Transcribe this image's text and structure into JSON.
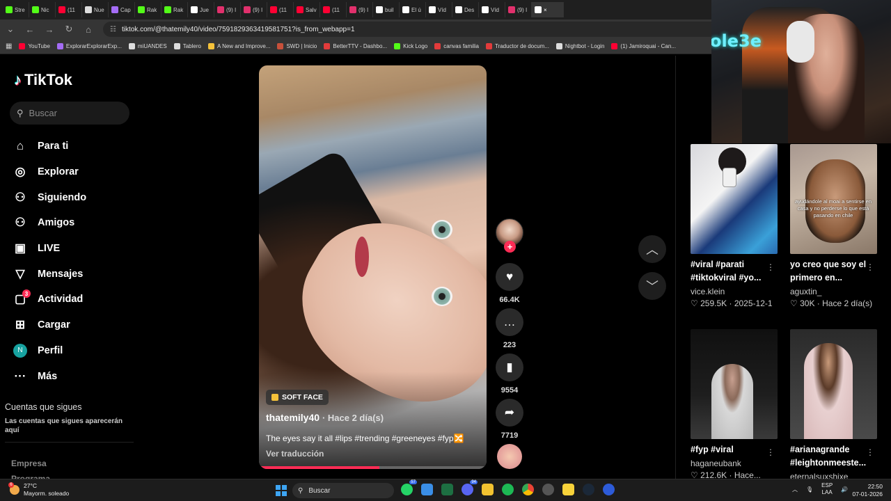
{
  "browser": {
    "tabs": [
      {
        "label": "Stre",
        "icon": "kick-icon",
        "color": "#53fc18"
      },
      {
        "label": "Nic",
        "icon": "kick-icon",
        "color": "#53fc18"
      },
      {
        "label": "(11",
        "icon": "youtube-icon",
        "color": "#ff0033"
      },
      {
        "label": "Nue",
        "icon": "openai-icon",
        "color": "#dddddd"
      },
      {
        "label": "Cap",
        "icon": "capcut-icon",
        "color": "#a46cf5"
      },
      {
        "label": "Rak",
        "icon": "kick-icon",
        "color": "#53fc18"
      },
      {
        "label": "Rak",
        "icon": "kick-icon",
        "color": "#53fc18"
      },
      {
        "label": "Jue",
        "icon": "tiktok-icon",
        "color": "#ffffff"
      },
      {
        "label": "(9) I",
        "icon": "instagram-icon",
        "color": "#e1306c"
      },
      {
        "label": "(9) I",
        "icon": "instagram-icon",
        "color": "#e1306c"
      },
      {
        "label": "(11",
        "icon": "youtube-icon",
        "color": "#ff0033"
      },
      {
        "label": "Salv",
        "icon": "youtube-icon",
        "color": "#ff0033"
      },
      {
        "label": "(11",
        "icon": "youtube-icon",
        "color": "#ff0033"
      },
      {
        "label": "(9) I",
        "icon": "instagram-icon",
        "color": "#e1306c"
      },
      {
        "label": "buil",
        "icon": "tiktok-icon",
        "color": "#ffffff"
      },
      {
        "label": "El ú",
        "icon": "tiktok-icon",
        "color": "#ffffff"
      },
      {
        "label": "Víd",
        "icon": "tiktok-icon",
        "color": "#ffffff"
      },
      {
        "label": "Des",
        "icon": "tiktok-icon",
        "color": "#ffffff"
      },
      {
        "label": "Víd",
        "icon": "tiktok-icon",
        "color": "#ffffff"
      },
      {
        "label": "(9) I",
        "icon": "instagram-icon",
        "color": "#e1306c"
      },
      {
        "label": "×",
        "icon": "tiktok-icon",
        "color": "#ffffff",
        "active": true
      }
    ],
    "url": "tiktok.com/@thatemily40/video/7591829363419581751?is_from_webapp=1",
    "bookmarks": [
      {
        "label": "YouTube",
        "color": "#ff0033"
      },
      {
        "label": "ExplorarExplorarExp...",
        "color": "#a46cf5"
      },
      {
        "label": "miUANDES",
        "color": "#dddddd"
      },
      {
        "label": "Tablero",
        "color": "#dddddd"
      },
      {
        "label": "A New and Improve...",
        "color": "#f5c23a"
      },
      {
        "label": "SWD | Inicio",
        "color": "#c8503a"
      },
      {
        "label": "BetterTTV - Dashbo...",
        "color": "#e33b3b"
      },
      {
        "label": "Kick Logo",
        "color": "#53fc18"
      },
      {
        "label": "canvas familia",
        "color": "#e33b3b"
      },
      {
        "label": "Traductor de docum...",
        "color": "#e33b3b"
      },
      {
        "label": "Nightbot - Login",
        "color": "#dddddd"
      },
      {
        "label": "(1) Jamiroquai - Can...",
        "color": "#ff0033"
      }
    ]
  },
  "tiktok": {
    "brand": "TikTok",
    "search_placeholder": "Buscar",
    "nav": [
      {
        "label": "Para ti",
        "icon": "home-icon",
        "glyph": "⌂"
      },
      {
        "label": "Explorar",
        "icon": "compass-icon",
        "glyph": "◎"
      },
      {
        "label": "Siguiendo",
        "icon": "following-icon",
        "glyph": "⚇"
      },
      {
        "label": "Amigos",
        "icon": "friends-icon",
        "glyph": "⚇"
      },
      {
        "label": "LIVE",
        "icon": "live-icon",
        "glyph": "▣"
      },
      {
        "label": "Mensajes",
        "icon": "messages-icon",
        "glyph": "▽"
      },
      {
        "label": "Actividad",
        "icon": "activity-icon",
        "glyph": "▢",
        "badge": "3"
      },
      {
        "label": "Cargar",
        "icon": "upload-icon",
        "glyph": "⊞"
      },
      {
        "label": "Perfil",
        "icon": "profile-avatar",
        "glyph": "N"
      },
      {
        "label": "Más",
        "icon": "more-icon",
        "glyph": "···"
      }
    ],
    "following_heading": "Cuentas que sigues",
    "following_placeholder": "Las cuentas que sigues aparecerán aquí",
    "footer": [
      "Empresa",
      "Programa"
    ]
  },
  "video": {
    "tag": "SOFT FACE",
    "author": "thatemily40",
    "posted": "· Hace 2 día(s)",
    "description": "The eyes say it all #lips #trending #greeneyes #fyp🔀",
    "translate": "Ver traducción",
    "progress": 0.53
  },
  "actions": {
    "likes": "66.4K",
    "comments": "223",
    "saves": "9554",
    "shares": "7719"
  },
  "recommended": [
    {
      "title": "#viral #parati #tiktokviral #yo...",
      "author": "vice.klein",
      "likes": "259.5K",
      "date": "2025-12-1"
    },
    {
      "title": "yo creo que soy el primero en...",
      "author": "aguxtin_",
      "likes": "30K",
      "date": "Hace 2 día(s)",
      "overlay": "ayudándole al moai a sentirse en casa y no perderse lo que está pasando en chile"
    },
    {
      "title": "#fyp #viral",
      "author": "haganeubank",
      "likes": "212.6K",
      "date": "Hace..."
    },
    {
      "title": "#arianagrande #leightonmeeste...",
      "author": "eternalsuxshixe",
      "likes": "",
      "date": ""
    }
  ],
  "webcam": {
    "neon": "ole3e"
  },
  "taskbar": {
    "weather_temp": "27°C",
    "weather_desc": "Mayorm. soleado",
    "weather_badge": "6",
    "search": "Buscar",
    "lang1": "ESP",
    "lang2": "LAA",
    "time": "22:50",
    "date": "07-01-2026",
    "badges": {
      "whatsapp": "57",
      "discord": "94"
    }
  },
  "colors": {
    "accent": "#fe2c55",
    "cyan": "#25f4ee"
  }
}
